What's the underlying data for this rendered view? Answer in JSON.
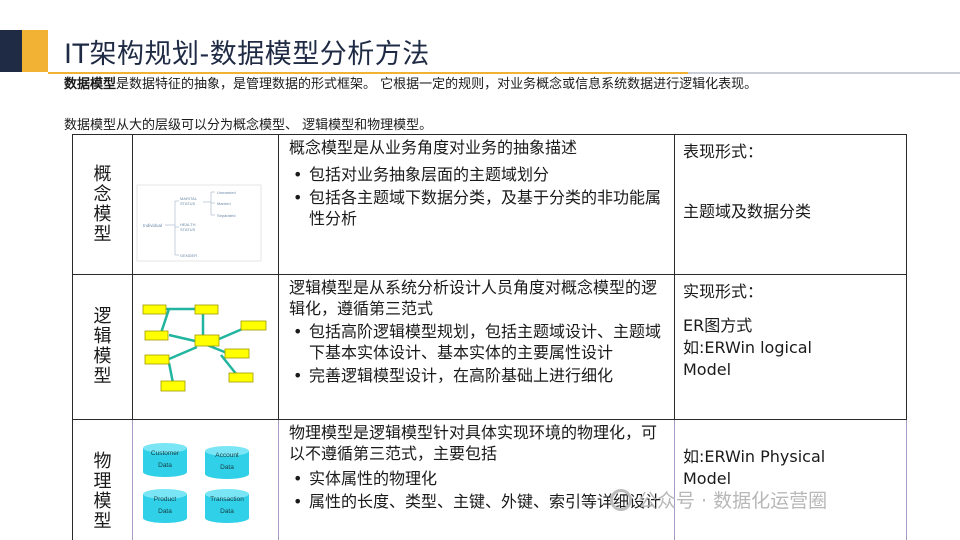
{
  "title": "IT架构规划-数据模型分析方法",
  "intro": {
    "bold": "数据模型",
    "line1_rest": "是数据特征的抽象，是管理数据的形式框架。 它根据一定的规则，对业务概念或信息系统数据进行逻辑化表现。",
    "line2": "数据模型从大的层级可以分为概念模型、 逻辑模型和物理模型。"
  },
  "rows": [
    {
      "label": "概念模型",
      "desc_head": "概念模型是从业务角度对业务的抽象描述",
      "bullets": [
        "包括对业务抽象层面的主题域划分",
        "包括各主题域下数据分类，及基于分类的非功能属性分析"
      ],
      "form_title": "表现形式：",
      "form_lines": [
        "主题域及数据分类"
      ],
      "diagram": {
        "root": "Individual",
        "branches": [
          "MARITAL STATUS",
          "HEALTH STATUS",
          "GENDER"
        ],
        "leaves": [
          "Unmarried",
          "Married",
          "Separated"
        ]
      }
    },
    {
      "label": "逻辑模型",
      "desc_head": "逻辑模型是从系统分析设计人员角度对概念模型的逻辑化，遵循第三范式",
      "bullets": [
        "包括高阶逻辑模型规划，包括主题域设计、主题域下基本实体设计、基本实体的主要属性设计",
        "完善逻辑模型设计，在高阶基础上进行细化"
      ],
      "form_title": "实现形式：",
      "form_lines": [
        "ER图方式",
        "如:ERWin logical",
        "Model"
      ]
    },
    {
      "label": "物理模型",
      "desc_head": "物理模型是逻辑模型针对具体实现环境的物理化，可以不遵循第三范式，主要包括",
      "bullets": [
        "实体属性的物理化",
        "属性的长度、类型、主键、外键、索引等详细设计"
      ],
      "form_title": "",
      "form_lines": [
        "如:ERWin Physical",
        "Model"
      ],
      "diagram": {
        "dbs": [
          "Customer Data",
          "Account Data",
          "Product Data",
          "Transaction Data"
        ]
      }
    }
  ],
  "watermark": "公众号 · 数据化运营圈",
  "colors": {
    "navy": "#1f2a44",
    "gold": "#f2b233",
    "er_box": "#ffff00",
    "er_link": "#21b5a0",
    "db_teal": "#2fd0e8"
  }
}
